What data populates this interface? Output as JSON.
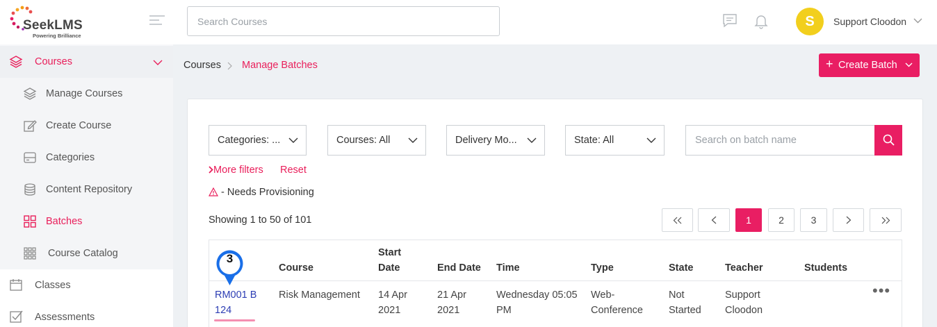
{
  "app": {
    "brand": "SeekLMS",
    "tagline": "Powering Brilliance"
  },
  "topbar": {
    "search_placeholder": "Search Courses",
    "user_initial": "S",
    "user_name": "Support Cloodon",
    "avatar_color": "#f2cf1d"
  },
  "sidebar": {
    "items": [
      {
        "label": "Courses",
        "icon": "layers-icon",
        "active": true
      },
      {
        "label": "Manage Courses",
        "icon": "layers-icon"
      },
      {
        "label": "Create Course",
        "icon": "edit-icon"
      },
      {
        "label": "Categories",
        "icon": "server-icon"
      },
      {
        "label": "Content Repository",
        "icon": "database-icon"
      },
      {
        "label": "Batches",
        "icon": "grid-icon",
        "active": true
      },
      {
        "label": "Course Catalog",
        "icon": "apps-icon"
      },
      {
        "label": "Classes",
        "icon": "calendar-icon"
      },
      {
        "label": "Assessments",
        "icon": "checkbox-icon"
      }
    ]
  },
  "breadcrumb": {
    "root": "Courses",
    "current": "Manage Batches"
  },
  "actions": {
    "create_batch": "Create Batch"
  },
  "filters": {
    "categories": "Categories: ...",
    "courses": "Courses: All",
    "delivery": "Delivery Mo...",
    "state": "State: All",
    "batch_search_placeholder": "Search on batch name",
    "more_filters": "More filters",
    "reset": "Reset",
    "needs_provisioning": "- Needs Provisioning"
  },
  "pagination": {
    "showing": "Showing 1 to 50 of 101",
    "pages": [
      "1",
      "2",
      "3"
    ],
    "current_page": "1"
  },
  "table": {
    "headers": {
      "course": "Course",
      "start_date_1": "Start",
      "start_date_2": "Date",
      "end_date": "End Date",
      "time": "Time",
      "type": "Type",
      "state": "State",
      "teacher": "Teacher",
      "students": "Students"
    },
    "rows": [
      {
        "batch_1": "RM001 B",
        "batch_2": "124",
        "course": "Risk Management",
        "start_1": "14 Apr",
        "start_2": "2021",
        "end_1": "21 Apr",
        "end_2": "2021",
        "time_1": "Wednesday 05:05",
        "time_2": "PM",
        "type_1": "Web-",
        "type_2": "Conference",
        "state_1": "Not",
        "state_2": "Started",
        "teacher_1": "Support",
        "teacher_2": "Cloodon",
        "students": ""
      }
    ]
  },
  "marker": {
    "number": "3"
  },
  "colors": {
    "accent": "#e91e63",
    "link": "#2d3eb4",
    "sidebar_bg": "#f7f8fa"
  }
}
